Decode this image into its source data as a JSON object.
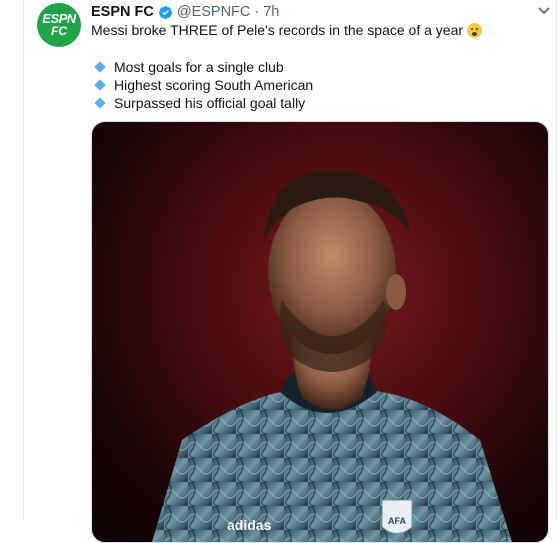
{
  "tweet": {
    "avatar_line1": "ESPN",
    "avatar_line2": "FC",
    "author_name": "ESPN FC",
    "handle": "@ESPNFC",
    "separator": "·",
    "time": "7h",
    "text": "Messi broke THREE of Pele's records in the space of a year",
    "emoji": "exploding-head-emoji",
    "bullets": [
      "Most goals for a single club",
      "Highest scoring South American",
      "Surpassed his official goal tally"
    ],
    "media": {
      "shirt_brand": "adidas",
      "crest_text": "AFA"
    }
  },
  "colors": {
    "accent": "#1d9bf0",
    "avatar_bg": "#21a34a",
    "bullet": "#5dadec"
  }
}
